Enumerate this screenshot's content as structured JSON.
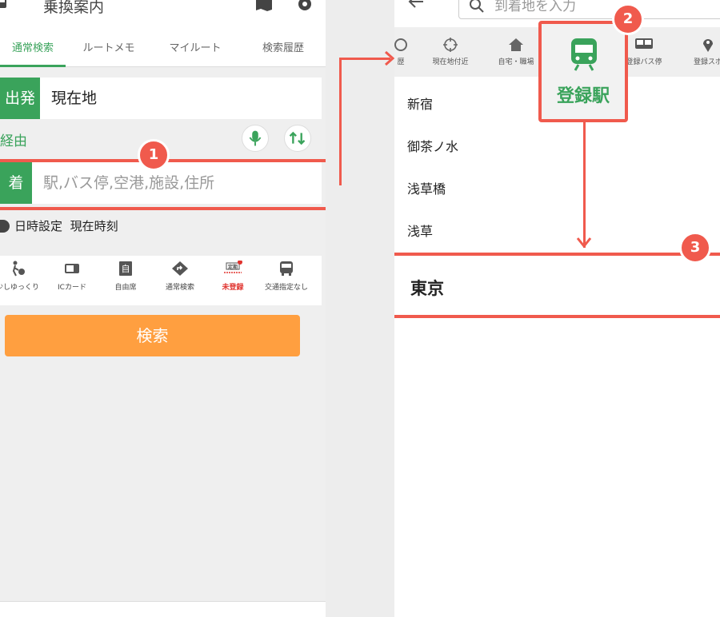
{
  "phone1": {
    "header": {
      "title": "乗換案内"
    },
    "tabs": [
      "通常検索",
      "ルートメモ",
      "マイルート",
      "検索履歴"
    ],
    "origin": {
      "chip": "出発",
      "value": "現在地"
    },
    "via": {
      "label": "経由"
    },
    "destination": {
      "chip": "着",
      "placeholder": "駅,バス停,空港,施設,住所"
    },
    "datetime": {
      "label": "日時設定",
      "value": "現在時刻"
    },
    "options": [
      {
        "label": "少しゆっくり",
        "icon": "walking-person-icon"
      },
      {
        "label": "ICカード",
        "icon": "ic-card-icon"
      },
      {
        "label": "自由席",
        "icon": "seat-icon"
      },
      {
        "label": "通常検索",
        "icon": "route-diamond-icon"
      },
      {
        "label": "未登録",
        "icon": "commuter-pass-icon",
        "badge": "定期"
      },
      {
        "label": "交通指定なし",
        "icon": "bus-icon"
      }
    ],
    "search_button": "検索"
  },
  "phone2": {
    "search": {
      "placeholder": "到着地を入力"
    },
    "strip": [
      {
        "label": "歴",
        "icon": "history-icon"
      },
      {
        "label": "現在地付近",
        "icon": "crosshair-icon"
      },
      {
        "label": "自宅・職場",
        "icon": "home-icon"
      },
      {
        "label": "登録駅",
        "icon": "train-icon"
      },
      {
        "label": "登録バス停",
        "icon": "bus-icon"
      },
      {
        "label": "登録スポ",
        "icon": "pin-icon"
      }
    ],
    "stations": [
      "新宿",
      "御茶ノ水",
      "浅草橋",
      "浅草",
      "東京"
    ]
  },
  "annotations": {
    "step1": "1",
    "step2": "2",
    "step3": "3"
  },
  "colors": {
    "accent_green": "#3aa35b",
    "search_orange": "#ff9f40",
    "highlight_red": "#f05a4d"
  }
}
